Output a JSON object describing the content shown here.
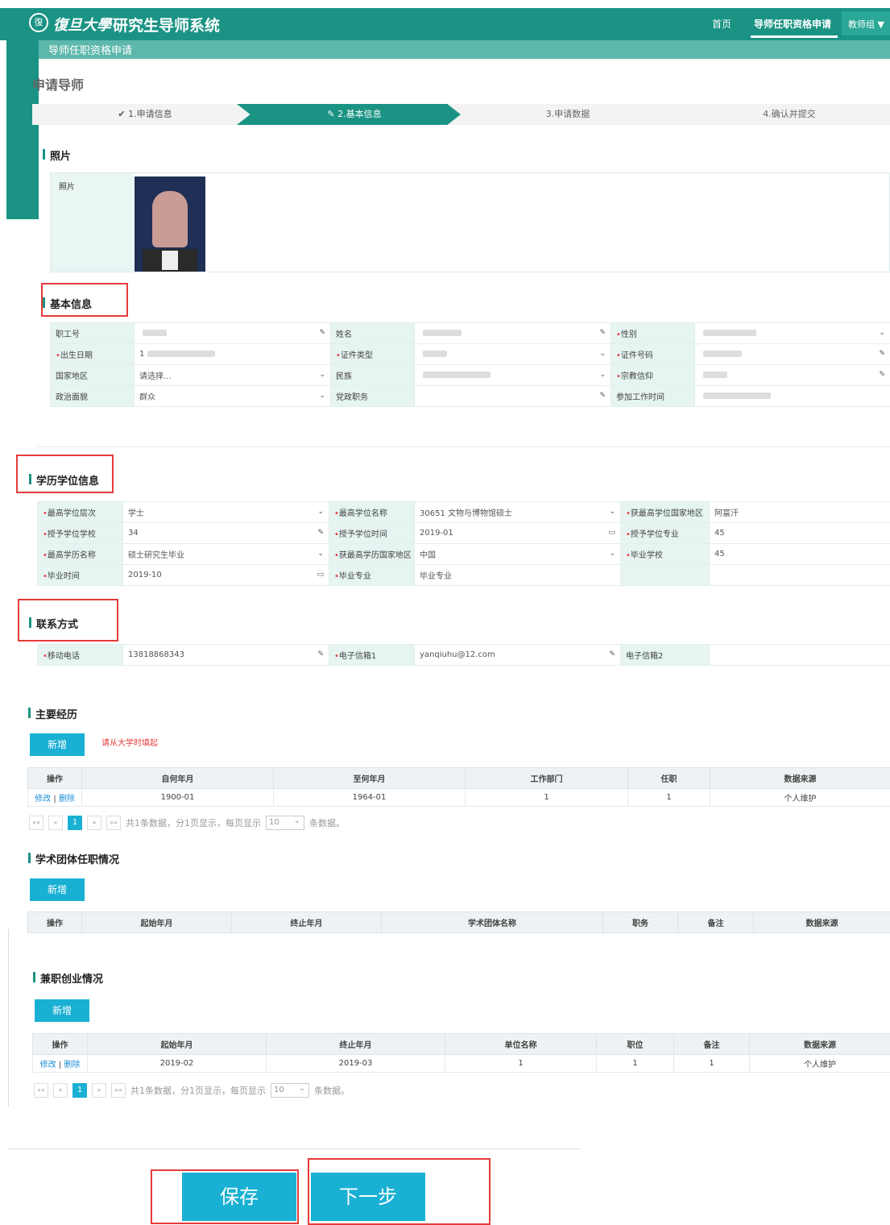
{
  "header": {
    "seal": "復",
    "logo": "復旦大學",
    "system_title": "研究生导师系统",
    "nav": [
      "首页",
      "导师任职资格申请"
    ],
    "user": "教师组 ▼"
  },
  "subbar": "导师任职资格申请",
  "page_title": "申请导师",
  "steps": [
    "✔ 1.申请信息",
    "✎ 2.基本信息",
    "3.申请数据",
    "4.确认并提交"
  ],
  "photo": {
    "title": "照片",
    "label": "照片"
  },
  "basic": {
    "title": "基本信息",
    "rows": [
      [
        {
          "l": "职工号",
          "r": false,
          "v": "",
          "b": true,
          "i": "✎"
        },
        {
          "l": "姓名",
          "r": false,
          "v": "",
          "b": true,
          "i": "✎"
        },
        {
          "l": "性别",
          "r": true,
          "v": "",
          "b": true,
          "i": "⌄"
        }
      ],
      [
        {
          "l": "出生日期",
          "r": true,
          "v": "1",
          "b": true,
          "i": ""
        },
        {
          "l": "证件类型",
          "r": true,
          "v": "",
          "b": true,
          "i": "⌄"
        },
        {
          "l": "证件号码",
          "r": true,
          "v": "",
          "b": true,
          "i": "✎"
        }
      ],
      [
        {
          "l": "国家地区",
          "r": false,
          "v": "请选择...",
          "b": false,
          "i": "⌄"
        },
        {
          "l": "民族",
          "r": false,
          "v": "",
          "b": true,
          "i": "⌄"
        },
        {
          "l": "宗教信仰",
          "r": true,
          "v": "",
          "b": true,
          "i": "✎"
        }
      ],
      [
        {
          "l": "政治面貌",
          "r": false,
          "v": "群众",
          "b": false,
          "i": "⌄"
        },
        {
          "l": "党政职务",
          "r": false,
          "v": "",
          "b": false,
          "i": "✎"
        },
        {
          "l": "参加工作时间",
          "r": false,
          "v": "",
          "b": true,
          "i": ""
        }
      ]
    ]
  },
  "edu": {
    "title": "学历学位信息",
    "rows": [
      [
        {
          "l": "最高学位层次",
          "r": true,
          "v": "学士",
          "i": "⌄"
        },
        {
          "l": "最高学位名称",
          "r": true,
          "v": "30651 文物与博物馆硕士",
          "i": "⌄"
        },
        {
          "l": "获最高学位国家地区",
          "r": true,
          "v": "阿富汗",
          "i": ""
        }
      ],
      [
        {
          "l": "授予学位学校",
          "r": true,
          "v": "34",
          "i": "✎"
        },
        {
          "l": "授予学位时间",
          "r": true,
          "v": "2019-01",
          "i": "▭"
        },
        {
          "l": "授予学位专业",
          "r": true,
          "v": "45",
          "i": ""
        }
      ],
      [
        {
          "l": "最高学历名称",
          "r": true,
          "v": "硕士研究生毕业",
          "i": "⌄"
        },
        {
          "l": "获最高学历国家地区",
          "r": true,
          "v": "中国",
          "i": "⌄"
        },
        {
          "l": "毕业学校",
          "r": true,
          "v": "45",
          "i": ""
        }
      ],
      [
        {
          "l": "毕业时间",
          "r": true,
          "v": "2019-10",
          "i": "▭"
        },
        {
          "l": "毕业专业",
          "r": true,
          "v": "毕业专业",
          "i": ""
        },
        {
          "l": "",
          "r": false,
          "v": "",
          "i": ""
        }
      ]
    ]
  },
  "contact": {
    "title": "联系方式",
    "rows": [
      [
        {
          "l": "移动电话",
          "r": true,
          "v": "13818868343",
          "i": "✎"
        },
        {
          "l": "电子信箱1",
          "r": true,
          "v": "yanqiuhu@12.com",
          "i": "✎"
        },
        {
          "l": "电子信箱2",
          "r": false,
          "v": "",
          "i": ""
        }
      ]
    ]
  },
  "experience": {
    "title": "主要经历",
    "add": "新增",
    "hint": "请从大学时填起",
    "headers": [
      "操作",
      "自何年月",
      "至何年月",
      "工作部门",
      "任职",
      "数据来源"
    ],
    "rows": [
      [
        "修改 | 删除",
        "1900-01",
        "1964-01",
        "1",
        "1",
        "个人维护"
      ]
    ],
    "pager": {
      "first": "««",
      "prev": "«",
      "page": "1",
      "next": "»",
      "last": "»»",
      "info": "共1条数据，分1页显示，每页显示",
      "size": "10",
      "suffix": "条数据。"
    }
  },
  "academic": {
    "title": "学术团体任职情况",
    "add": "新增",
    "headers": [
      "操作",
      "起始年月",
      "终止年月",
      "学术团体名称",
      "职务",
      "备注",
      "数据来源"
    ]
  },
  "parttime": {
    "title": "兼职创业情况",
    "add": "新增",
    "headers": [
      "操作",
      "起始年月",
      "终止年月",
      "单位名称",
      "职位",
      "备注",
      "数据来源"
    ],
    "rows": [
      [
        "修改 | 删除",
        "2019-02",
        "2019-03",
        "1",
        "1",
        "1",
        "个人维护"
      ]
    ],
    "pager": {
      "first": "««",
      "prev": "«",
      "page": "1",
      "next": "»",
      "last": "»»",
      "info": "共1条数据，分1页显示，每页显示",
      "size": "10",
      "suffix": "条数据。"
    }
  },
  "buttons": {
    "save": "保存",
    "next": "下一步"
  }
}
